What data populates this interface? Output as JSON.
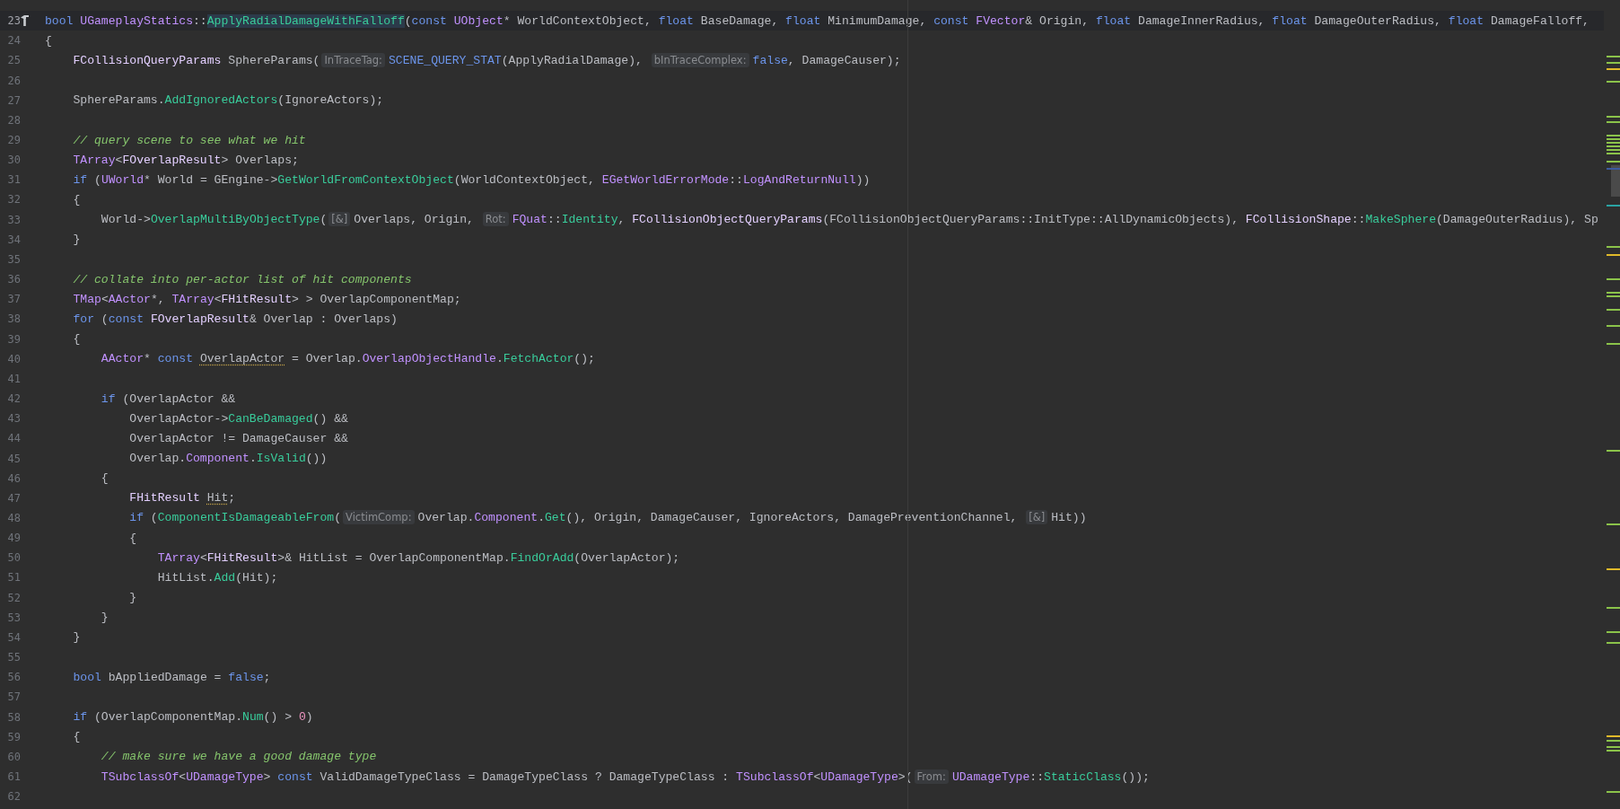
{
  "editor": {
    "lines": [
      {
        "number": "23",
        "current": true,
        "build_icon": true,
        "tokens": [
          {
            "kind": "kw",
            "text": "bool"
          },
          {
            "kind": "cls",
            "text": " UGameplayStatics"
          },
          {
            "kind": "p",
            "text": "::"
          },
          {
            "kind": "decl",
            "text": "ApplyRadialDamageWithFalloff"
          },
          {
            "kind": "p",
            "text": "("
          },
          {
            "kind": "kw",
            "text": "const"
          },
          {
            "kind": "cls",
            "text": " UObject"
          },
          {
            "kind": "p",
            "text": "* WorldContextObject, "
          },
          {
            "kind": "kw",
            "text": "float"
          },
          {
            "kind": "p",
            "text": " BaseDamage, "
          },
          {
            "kind": "kw",
            "text": "float"
          },
          {
            "kind": "p",
            "text": " MinimumDamage, "
          },
          {
            "kind": "kw",
            "text": "const"
          },
          {
            "kind": "cls",
            "text": " FVector"
          },
          {
            "kind": "p",
            "text": "& Origin, "
          },
          {
            "kind": "kw",
            "text": "float"
          },
          {
            "kind": "p",
            "text": " DamageInnerRadius, "
          },
          {
            "kind": "kw",
            "text": "float"
          },
          {
            "kind": "p",
            "text": " DamageOuterRadius, "
          },
          {
            "kind": "kw",
            "text": "float"
          },
          {
            "kind": "p",
            "text": " DamageFalloff,"
          }
        ]
      },
      {
        "number": "24",
        "current": false,
        "tokens": [
          {
            "kind": "p",
            "text": "{"
          }
        ]
      },
      {
        "number": "25",
        "current": false,
        "tokens": [
          {
            "kind": "st",
            "text": "    FCollisionQueryParams"
          },
          {
            "kind": "p",
            "text": " SphereParams("
          },
          {
            "kind": "hint",
            "text": "InTraceTag:"
          },
          {
            "kind": "kw",
            "text": "SCENE_QUERY_STAT"
          },
          {
            "kind": "p",
            "text": "(ApplyRadialDamage), "
          },
          {
            "kind": "hint",
            "text": "bInTraceComplex:"
          },
          {
            "kind": "kw",
            "text": "false"
          },
          {
            "kind": "p",
            "text": ", DamageCauser);"
          }
        ]
      },
      {
        "number": "26",
        "current": false
      },
      {
        "number": "27",
        "current": false,
        "tokens": [
          {
            "kind": "p",
            "text": "    SphereParams."
          },
          {
            "kind": "fn",
            "text": "AddIgnoredActors"
          },
          {
            "kind": "p",
            "text": "(IgnoreActors);"
          }
        ]
      },
      {
        "number": "28",
        "current": false
      },
      {
        "number": "29",
        "current": false,
        "tokens": [
          {
            "kind": "cm",
            "text": "    // query scene to see what we hit"
          }
        ]
      },
      {
        "number": "30",
        "current": false,
        "tokens": [
          {
            "kind": "cls",
            "text": "    TArray"
          },
          {
            "kind": "p",
            "text": "<"
          },
          {
            "kind": "st",
            "text": "FOverlapResult"
          },
          {
            "kind": "p",
            "text": "> Overlaps;"
          }
        ]
      },
      {
        "number": "31",
        "current": false,
        "tokens": [
          {
            "kind": "kw",
            "text": "    if"
          },
          {
            "kind": "p",
            "text": " ("
          },
          {
            "kind": "cls",
            "text": "UWorld"
          },
          {
            "kind": "p",
            "text": "* World = GEngine->"
          },
          {
            "kind": "fn",
            "text": "GetWorldFromContextObject"
          },
          {
            "kind": "p",
            "text": "(WorldContextObject, "
          },
          {
            "kind": "cls",
            "text": "EGetWorldErrorMode"
          },
          {
            "kind": "p",
            "text": "::"
          },
          {
            "kind": "cls",
            "text": "LogAndReturnNull"
          },
          {
            "kind": "p",
            "text": "))"
          }
        ]
      },
      {
        "number": "32",
        "current": false,
        "tokens": [
          {
            "kind": "p",
            "text": "    {"
          }
        ]
      },
      {
        "number": "33",
        "current": false,
        "tokens": [
          {
            "kind": "p",
            "text": "        World->"
          },
          {
            "kind": "fn",
            "text": "OverlapMultiByObjectType"
          },
          {
            "kind": "p",
            "text": "("
          },
          {
            "kind": "hint",
            "text": "[&]"
          },
          {
            "kind": "p",
            "text": "Overlaps, Origin, "
          },
          {
            "kind": "hint",
            "text": "Rot:"
          },
          {
            "kind": "cls",
            "text": "FQuat"
          },
          {
            "kind": "p",
            "text": "::"
          },
          {
            "kind": "fn",
            "text": "Identity"
          },
          {
            "kind": "p",
            "text": ", "
          },
          {
            "kind": "st",
            "text": "FCollisionObjectQueryParams"
          },
          {
            "kind": "p",
            "text": "(FCollisionObjectQueryParams::InitType::AllDynamicObjects), "
          },
          {
            "kind": "st",
            "text": "FCollisionShape"
          },
          {
            "kind": "p",
            "text": "::"
          },
          {
            "kind": "fn",
            "text": "MakeSphere"
          },
          {
            "kind": "p",
            "text": "(DamageOuterRadius), Sp"
          }
        ]
      },
      {
        "number": "34",
        "current": false,
        "tokens": [
          {
            "kind": "p",
            "text": "    }"
          }
        ]
      },
      {
        "number": "35",
        "current": false
      },
      {
        "number": "36",
        "current": false,
        "tokens": [
          {
            "kind": "cm",
            "text": "    // collate into per-actor list of hit components"
          }
        ]
      },
      {
        "number": "37",
        "current": false,
        "tokens": [
          {
            "kind": "cls",
            "text": "    TMap"
          },
          {
            "kind": "p",
            "text": "<"
          },
          {
            "kind": "cls",
            "text": "AActor"
          },
          {
            "kind": "p",
            "text": "*, "
          },
          {
            "kind": "cls",
            "text": "TArray"
          },
          {
            "kind": "p",
            "text": "<"
          },
          {
            "kind": "st",
            "text": "FHitResult"
          },
          {
            "kind": "p",
            "text": "> > OverlapComponentMap;"
          }
        ]
      },
      {
        "number": "38",
        "current": false,
        "tokens": [
          {
            "kind": "kw",
            "text": "    for"
          },
          {
            "kind": "p",
            "text": " ("
          },
          {
            "kind": "kw",
            "text": "const"
          },
          {
            "kind": "st",
            "text": " FOverlapResult"
          },
          {
            "kind": "p",
            "text": "& Overlap : Overlaps)"
          }
        ]
      },
      {
        "number": "39",
        "current": false,
        "tokens": [
          {
            "kind": "p",
            "text": "    {"
          }
        ]
      },
      {
        "number": "40",
        "current": false,
        "tokens": [
          {
            "kind": "cls",
            "text": "        AActor"
          },
          {
            "kind": "p",
            "text": "* "
          },
          {
            "kind": "kw",
            "text": "const "
          },
          {
            "kind": "warn",
            "text": "OverlapActor"
          },
          {
            "kind": "p",
            "text": " = Overlap."
          },
          {
            "kind": "cls",
            "text": "OverlapObjectHandle"
          },
          {
            "kind": "p",
            "text": "."
          },
          {
            "kind": "fn",
            "text": "FetchActor"
          },
          {
            "kind": "p",
            "text": "();"
          }
        ]
      },
      {
        "number": "41",
        "current": false
      },
      {
        "number": "42",
        "current": false,
        "tokens": [
          {
            "kind": "kw",
            "text": "        if"
          },
          {
            "kind": "p",
            "text": " (OverlapActor &&"
          }
        ]
      },
      {
        "number": "43",
        "current": false,
        "tokens": [
          {
            "kind": "p",
            "text": "            OverlapActor->"
          },
          {
            "kind": "fn",
            "text": "CanBeDamaged"
          },
          {
            "kind": "p",
            "text": "() &&"
          }
        ]
      },
      {
        "number": "44",
        "current": false,
        "tokens": [
          {
            "kind": "p",
            "text": "            OverlapActor != DamageCauser &&"
          }
        ]
      },
      {
        "number": "45",
        "current": false,
        "tokens": [
          {
            "kind": "p",
            "text": "            Overlap."
          },
          {
            "kind": "cls",
            "text": "Component"
          },
          {
            "kind": "p",
            "text": "."
          },
          {
            "kind": "fn",
            "text": "IsValid"
          },
          {
            "kind": "p",
            "text": "())"
          }
        ]
      },
      {
        "number": "46",
        "current": false,
        "tokens": [
          {
            "kind": "p",
            "text": "        {"
          }
        ]
      },
      {
        "number": "47",
        "current": false,
        "tokens": [
          {
            "kind": "st",
            "text": "            FHitResult "
          },
          {
            "kind": "warn",
            "text": "Hit"
          },
          {
            "kind": "p",
            "text": ";"
          }
        ]
      },
      {
        "number": "48",
        "current": false,
        "tokens": [
          {
            "kind": "kw",
            "text": "            if"
          },
          {
            "kind": "p",
            "text": " ("
          },
          {
            "kind": "fn",
            "text": "ComponentIsDamageableFrom"
          },
          {
            "kind": "p",
            "text": "("
          },
          {
            "kind": "hint",
            "text": "VictimComp:"
          },
          {
            "kind": "p",
            "text": "Overlap."
          },
          {
            "kind": "cls",
            "text": "Component"
          },
          {
            "kind": "p",
            "text": "."
          },
          {
            "kind": "fn",
            "text": "Get"
          },
          {
            "kind": "p",
            "text": "(), Origin, DamageCauser, IgnoreActors, DamagePreventionChannel, "
          },
          {
            "kind": "hint",
            "text": "[&]"
          },
          {
            "kind": "p",
            "text": "Hit))"
          }
        ]
      },
      {
        "number": "49",
        "current": false,
        "tokens": [
          {
            "kind": "p",
            "text": "            {"
          }
        ]
      },
      {
        "number": "50",
        "current": false,
        "tokens": [
          {
            "kind": "cls",
            "text": "                TArray"
          },
          {
            "kind": "p",
            "text": "<"
          },
          {
            "kind": "st",
            "text": "FHitResult"
          },
          {
            "kind": "p",
            "text": ">& HitList = OverlapComponentMap."
          },
          {
            "kind": "fn",
            "text": "FindOrAdd"
          },
          {
            "kind": "p",
            "text": "(OverlapActor);"
          }
        ]
      },
      {
        "number": "51",
        "current": false,
        "tokens": [
          {
            "kind": "p",
            "text": "                HitList."
          },
          {
            "kind": "fn",
            "text": "Add"
          },
          {
            "kind": "p",
            "text": "(Hit);"
          }
        ]
      },
      {
        "number": "52",
        "current": false,
        "tokens": [
          {
            "kind": "p",
            "text": "            }"
          }
        ]
      },
      {
        "number": "53",
        "current": false,
        "tokens": [
          {
            "kind": "p",
            "text": "        }"
          }
        ]
      },
      {
        "number": "54",
        "current": false,
        "tokens": [
          {
            "kind": "p",
            "text": "    }"
          }
        ]
      },
      {
        "number": "55",
        "current": false
      },
      {
        "number": "56",
        "current": false,
        "tokens": [
          {
            "kind": "kw",
            "text": "    bool"
          },
          {
            "kind": "p",
            "text": " bAppliedDamage = "
          },
          {
            "kind": "kw",
            "text": "false"
          },
          {
            "kind": "p",
            "text": ";"
          }
        ]
      },
      {
        "number": "57",
        "current": false
      },
      {
        "number": "58",
        "current": false,
        "tokens": [
          {
            "kind": "kw",
            "text": "    if"
          },
          {
            "kind": "p",
            "text": " (OverlapComponentMap."
          },
          {
            "kind": "fn",
            "text": "Num"
          },
          {
            "kind": "p",
            "text": "() > "
          },
          {
            "kind": "num",
            "text": "0"
          },
          {
            "kind": "p",
            "text": ")"
          }
        ]
      },
      {
        "number": "59",
        "current": false,
        "tokens": [
          {
            "kind": "p",
            "text": "    {"
          }
        ]
      },
      {
        "number": "60",
        "current": false,
        "tokens": [
          {
            "kind": "cm",
            "text": "        // make sure we have a good damage type"
          }
        ]
      },
      {
        "number": "61",
        "current": false,
        "tokens": [
          {
            "kind": "cls",
            "text": "        TSubclassOf"
          },
          {
            "kind": "p",
            "text": "<"
          },
          {
            "kind": "cls",
            "text": "UDamageType"
          },
          {
            "kind": "p",
            "text": "> "
          },
          {
            "kind": "kw",
            "text": "const"
          },
          {
            "kind": "p",
            "text": " ValidDamageTypeClass = DamageTypeClass ? DamageTypeClass : "
          },
          {
            "kind": "cls",
            "text": "TSubclassOf"
          },
          {
            "kind": "p",
            "text": "<"
          },
          {
            "kind": "cls",
            "text": "UDamageType"
          },
          {
            "kind": "p",
            "text": ">("
          },
          {
            "kind": "hint",
            "text": "From:"
          },
          {
            "kind": "cls",
            "text": "UDamageType"
          },
          {
            "kind": "p",
            "text": "::"
          },
          {
            "kind": "fn",
            "text": "StaticClass"
          },
          {
            "kind": "p",
            "text": "());"
          }
        ]
      },
      {
        "number": "62",
        "current": false
      }
    ]
  }
}
